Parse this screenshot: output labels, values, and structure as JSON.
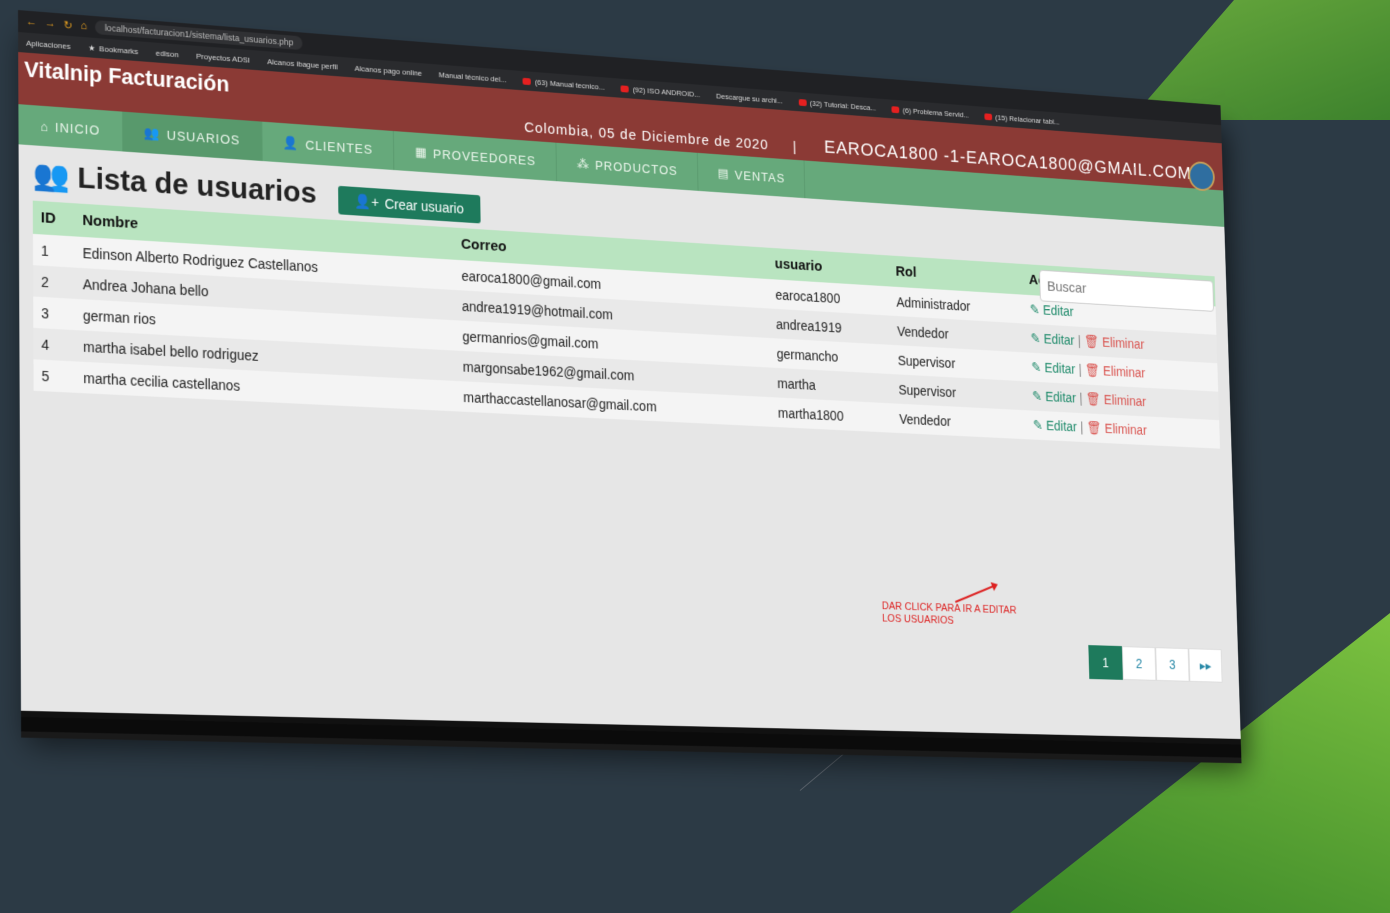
{
  "browser": {
    "url": "localhost/facturacion1/sistema/lista_usuarios.php",
    "bookmarks": [
      "Aplicaciones",
      "Bookmarks",
      "edison",
      "Proyectos ADSI",
      "Alcanos ibague perfil",
      "Alcanos pago online",
      "Manual técnico del...",
      "(63) Manual tecnico...",
      "(92) ISO ANDROID...",
      "Descargue su archi...",
      "(32) Tutorial: Desca...",
      "(6) Problema Servid...",
      "(15) Relacionar tabl..."
    ]
  },
  "header": {
    "brand": "Vitalnip Facturación",
    "date": "Colombia, 05 de Diciembre de 2020",
    "separator": "|",
    "user": "EAROCA1800 -1-EAROCA1800@GMAIL.COM"
  },
  "nav": {
    "items": [
      {
        "label": "INICIO",
        "icon": "home-icon"
      },
      {
        "label": "USUARIOS",
        "icon": "users-icon"
      },
      {
        "label": "CLIENTES",
        "icon": "user-icon"
      },
      {
        "label": "PROVEEDORES",
        "icon": "building-icon"
      },
      {
        "label": "PRODUCTOS",
        "icon": "cubes-icon"
      },
      {
        "label": "VENTAS",
        "icon": "file-icon"
      }
    ]
  },
  "page": {
    "title": "Lista de usuarios",
    "create_button": "Crear usuario",
    "search_placeholder": "Buscar"
  },
  "table": {
    "headers": [
      "ID",
      "Nombre",
      "Correo",
      "usuario",
      "Rol",
      "Acciones"
    ],
    "rows": [
      {
        "id": "1",
        "nombre": "Edinson Alberto Rodriguez Castellanos",
        "correo": "earoca1800@gmail.com",
        "usuario": "earoca1800",
        "rol": "Administrador",
        "edit": "Editar",
        "delete": ""
      },
      {
        "id": "2",
        "nombre": "Andrea Johana bello",
        "correo": "andrea1919@hotmail.com",
        "usuario": "andrea1919",
        "rol": "Vendedor",
        "edit": "Editar",
        "delete": "Eliminar"
      },
      {
        "id": "3",
        "nombre": "german rios",
        "correo": "germanrios@gmail.com",
        "usuario": "germancho",
        "rol": "Supervisor",
        "edit": "Editar",
        "delete": "Eliminar"
      },
      {
        "id": "4",
        "nombre": "martha isabel bello rodriguez",
        "correo": "margonsabe1962@gmail.com",
        "usuario": "martha",
        "rol": "Supervisor",
        "edit": "Editar",
        "delete": "Eliminar"
      },
      {
        "id": "5",
        "nombre": "martha cecilia castellanos",
        "correo": "marthaccastellanosar@gmail.com",
        "usuario": "martha1800",
        "rol": "Vendedor",
        "edit": "Editar",
        "delete": "Eliminar"
      }
    ]
  },
  "annotation": {
    "line1": "DAR CLICK PARA IR A EDITAR",
    "line2": "LOS USUARIOS"
  },
  "pagination": {
    "pages": [
      "1",
      "2",
      "3"
    ],
    "next": "▸▸",
    "active": "1"
  },
  "colors": {
    "header_bg": "#8b3a35",
    "nav_bg": "#66a97b",
    "accent": "#1e7a5c",
    "danger": "#d9534f",
    "table_head": "#b9e4c0"
  }
}
